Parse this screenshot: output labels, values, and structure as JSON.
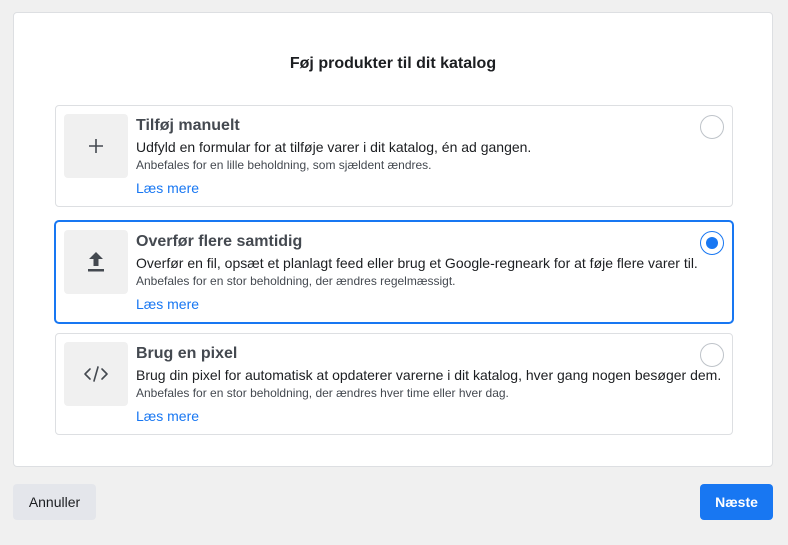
{
  "dialog": {
    "title": "Føj produkter til dit katalog"
  },
  "options": [
    {
      "icon": "plus-icon",
      "title": "Tilføj manuelt",
      "description": "Udfyld en formular for at tilføje varer i dit katalog, én ad gangen.",
      "recommendation": "Anbefales for en lille beholdning, som sjældent ændres.",
      "link": "Læs mere",
      "selected": false
    },
    {
      "icon": "upload-icon",
      "title": "Overfør flere samtidig",
      "description": "Overfør en fil, opsæt et planlagt feed eller brug et Google-regneark for at føje flere varer til.",
      "recommendation": "Anbefales for en stor beholdning, der ændres regelmæssigt.",
      "link": "Læs mere",
      "selected": true
    },
    {
      "icon": "code-icon",
      "title": "Brug en pixel",
      "description": "Brug din pixel for automatisk at opdaterer varerne i dit katalog, hver gang nogen besøger dem.",
      "recommendation": "Anbefales for en stor beholdning, der ændres hver time eller hver dag.",
      "link": "Læs mere",
      "selected": false
    }
  ],
  "footer": {
    "cancel_label": "Annuller",
    "next_label": "Næste"
  },
  "colors": {
    "accent": "#1877f2",
    "background": "#f0f0f0"
  }
}
